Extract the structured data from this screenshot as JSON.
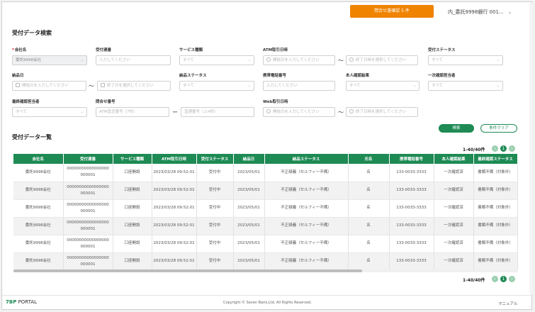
{
  "header": {
    "inquiry_button": "問合せ書確認 5 件",
    "user_menu": "内_委託9998銀行 001..."
  },
  "search": {
    "title": "受付データ検索",
    "fields": {
      "company": {
        "label": "会社名",
        "required": "*",
        "value": "委託9998会社"
      },
      "receipt_no": {
        "label": "受付連番",
        "placeholder": "入力してください"
      },
      "service": {
        "label": "サービス種類",
        "placeholder": "すべて"
      },
      "atm_date": {
        "label": "ATM取引日時",
        "from_placeholder": "開始日を入力してください",
        "to_placeholder": "終了日時を選択してください",
        "separator": "〜"
      },
      "receipt_status": {
        "label": "受付ステータス",
        "placeholder": "すべて"
      },
      "payment_date": {
        "label": "納品日",
        "from_placeholder": "開始日を入力してください",
        "to_placeholder": "終了日を選択してください",
        "separator": "〜"
      },
      "payment_status": {
        "label": "納品ステータス",
        "placeholder": "すべて"
      },
      "mobile": {
        "label": "携帯電話番号",
        "placeholder": "入力してください"
      },
      "identity": {
        "label": "本人確認結果",
        "placeholder": "すべて"
      },
      "first_checker": {
        "label": "一次確認担当者",
        "placeholder": "すべて"
      },
      "final_checker": {
        "label": "最終確認担当者",
        "placeholder": "すべて"
      },
      "inquiry_no": {
        "label": "問合せ番号",
        "from_placeholder": "ATM直近番号（7桁）",
        "to_placeholder": "直通番号（上4桁）",
        "separator": "ー"
      },
      "web_date": {
        "label": "Web取引日時",
        "from_placeholder": "開始日を入力してください",
        "to_placeholder": "終了日時を選択してください",
        "separator": "〜"
      }
    },
    "search_button": "検索",
    "clear_button": "条件クリア"
  },
  "results": {
    "title": "受付データ一覧",
    "pager_text": "1-40/40件",
    "current_page": "1",
    "prev": "‹",
    "next": "›",
    "columns": [
      "会社名",
      "受付連番",
      "サービス種類",
      "ATM取引日時",
      "受付ステータス",
      "納品日",
      "納品ステータス",
      "氏名",
      "携帯電話番号",
      "本人確認結果",
      "最終確認ステータス"
    ],
    "rows": [
      [
        "委託9998会社",
        "00000000000000000",
        "000001",
        "口座開設",
        "2023/03/28 09:52:01",
        "受付中",
        "2023/05/01",
        "不正疑義（セルフィー不備）",
        "名",
        "133-0033-3333",
        "一次確認済",
        "書類不備（対象外）"
      ],
      [
        "委託9998会社",
        "00000000000000000",
        "000001",
        "口座開設",
        "2023/03/28 09:52:01",
        "受付中",
        "2023/05/01",
        "不正疑義（セルフィー不備）",
        "名",
        "133-0033-3333",
        "一次確認済",
        "書類不備（対象外）"
      ],
      [
        "委託9998会社",
        "00000000000000000",
        "000001",
        "口座開設",
        "2023/03/28 09:52:01",
        "受付中",
        "2023/05/01",
        "不正疑義（セルフィー不備）",
        "名",
        "133-0033-3333",
        "一次確認済",
        "書類不備（対象外）"
      ],
      [
        "委託9998会社",
        "00000000000000000",
        "000001",
        "口座開設",
        "2023/03/28 09:52:01",
        "受付中",
        "2023/05/01",
        "不正疑義（セルフィー不備）",
        "名",
        "133-0033-3333",
        "一次確認済",
        "書類不備（対象外）"
      ],
      [
        "委託9998会社",
        "00000000000000000",
        "000001",
        "口座開設",
        "2023/03/28 09:52:01",
        "受付中",
        "2023/05/01",
        "不正疑義（セルフィー不備）",
        "名",
        "133-0033-3333",
        "一次確認済",
        "書類不備（対象外）"
      ],
      [
        "委託9998会社",
        "00000000000000000",
        "000001",
        "口座開設",
        "2023/03/28 09:52:01",
        "受付中",
        "2023/05/01",
        "不正疑義（セルフィー不備）",
        "名",
        "133-0033-3333",
        "一次確認済",
        "書類不備（対象外）"
      ]
    ]
  },
  "footer": {
    "logo_mark": "7BP",
    "logo_text": "PORTAL",
    "copyright": "Copyright © Seven Bank,Ltd. All Rights Reserved.",
    "manual": "マニュアル"
  },
  "colors": {
    "accent": "#1e8a54",
    "orange": "#f08300"
  }
}
